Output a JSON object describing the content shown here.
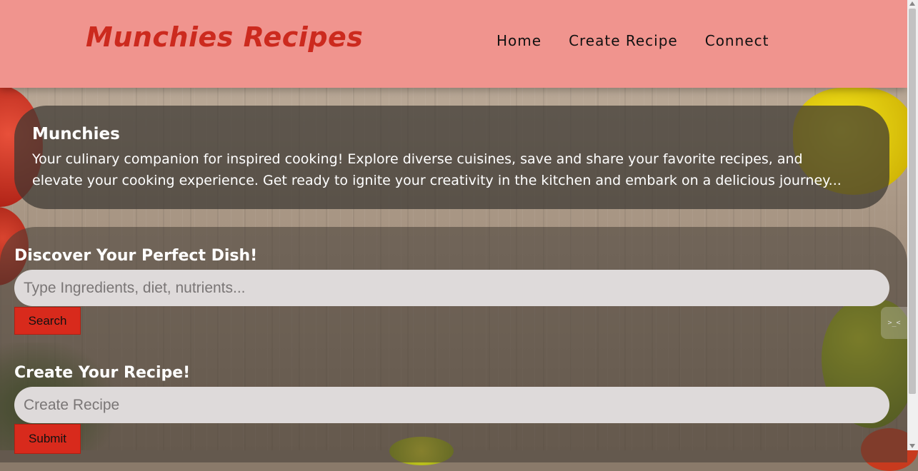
{
  "brand": {
    "name": "Munchies Recipes",
    "color": "#cc2a1e"
  },
  "header_bg": "#f0948e",
  "nav": {
    "items": [
      {
        "label": "Home"
      },
      {
        "label": "Create Recipe"
      },
      {
        "label": "Connect"
      }
    ]
  },
  "intro": {
    "title": "Munchies",
    "line1": "Your culinary companion for inspired cooking! Explore diverse cuisines, save and share your favorite recipes, and",
    "line2": "elevate your cooking experience. Get ready to ignite your creativity in the kitchen and embark on a delicious journey..."
  },
  "search": {
    "title": "Discover Your Perfect Dish!",
    "placeholder": "Type Ingredients, diet, nutrients...",
    "button_label": "Search"
  },
  "create": {
    "title": "Create Your Recipe!",
    "placeholder": "Create Recipe",
    "button_label": "Submit"
  },
  "side_tab": {
    "label": ">_<"
  },
  "button_color": "#d82a1c"
}
